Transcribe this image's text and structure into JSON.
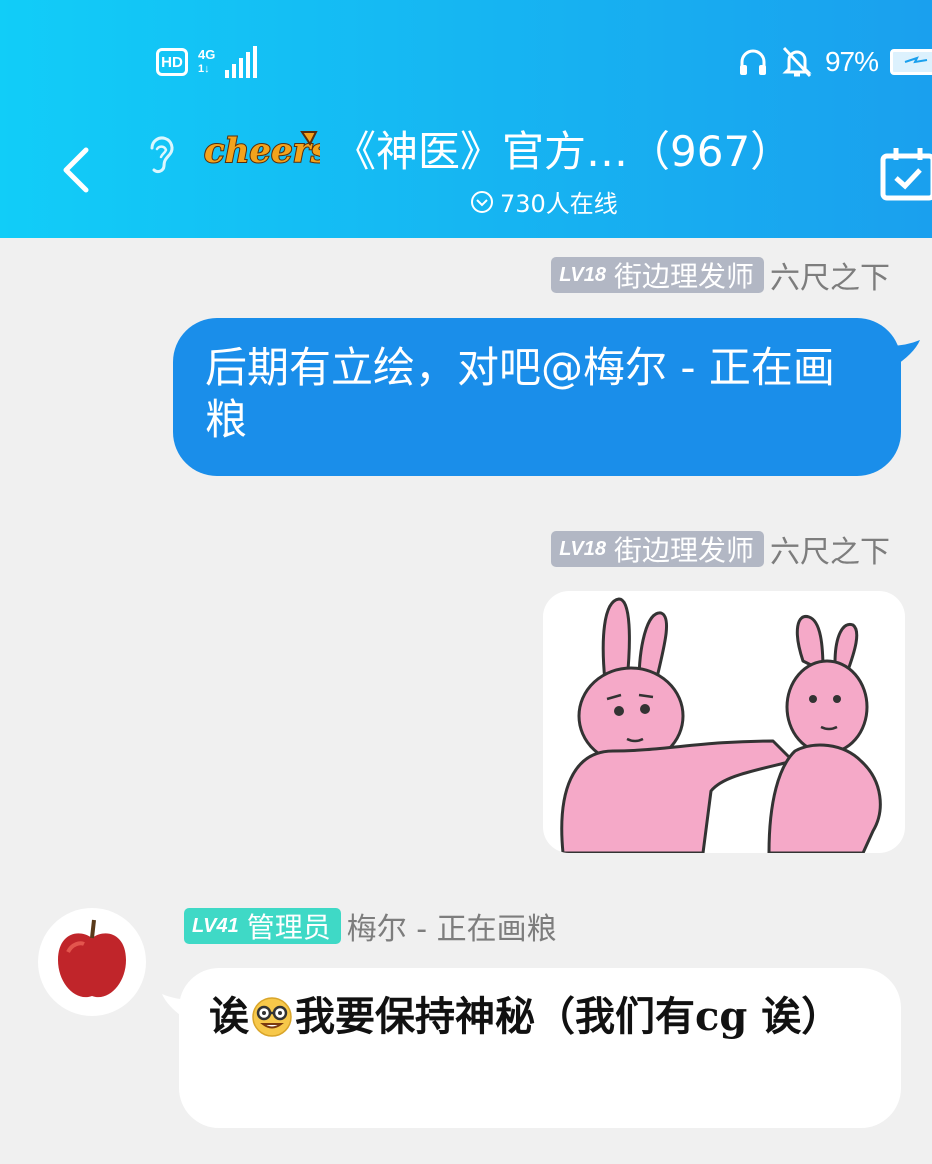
{
  "status_bar": {
    "hd": "HD",
    "network": "4G",
    "battery_percent": "97%",
    "battery_level": 0.97
  },
  "header": {
    "logo_text": "cheers",
    "title": "《神医》官方…（967）",
    "online": "730人在线"
  },
  "messages": [
    {
      "level": "LV18",
      "rank": "街边理发师",
      "nickname": "六尺之下",
      "text": "后期有立绘，对吧@梅尔 - 正在画粮",
      "side": "right"
    },
    {
      "level": "LV18",
      "rank": "街边理发师",
      "nickname": "六尺之下",
      "sticker": "pink-rabbits-sticker",
      "side": "right"
    },
    {
      "level": "LV41",
      "rank": "管理员",
      "nickname": "梅尔 - 正在画粮",
      "text_before": "诶",
      "emoji": "nerd-face-emoji",
      "text_after": "我要保持神秘（我们有cg 诶）",
      "side": "left"
    }
  ],
  "colors": {
    "header_start": "#11cdf8",
    "header_end": "#1aa0ee",
    "bubble_blue": "#1a8eea",
    "badge_gray": "#b2b7c4",
    "badge_teal": "#3fd9c6",
    "background": "#f0f0f0"
  }
}
